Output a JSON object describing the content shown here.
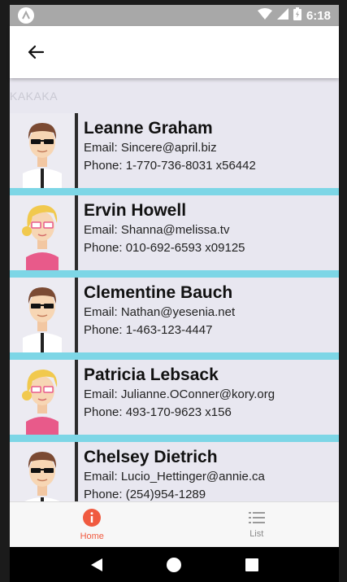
{
  "status_bar": {
    "time": "6:18",
    "accent": "#a8a8a8"
  },
  "app_bar": {
    "back_icon": "arrow-left-icon"
  },
  "section_label": "KAKAKA",
  "contacts": [
    {
      "name": "Leanne Graham",
      "email": "Email: Sincere@april.biz",
      "phone": "Phone: 1-770-736-8031 x56442",
      "avatar": "male-avatar"
    },
    {
      "name": "Ervin Howell",
      "email": "Email: Shanna@melissa.tv",
      "phone": "Phone: 010-692-6593 x09125",
      "avatar": "female-avatar"
    },
    {
      "name": "Clementine Bauch",
      "email": "Email: Nathan@yesenia.net",
      "phone": "Phone: 1-463-123-4447",
      "avatar": "male-avatar"
    },
    {
      "name": "Patricia Lebsack",
      "email": "Email: Julianne.OConner@kory.org",
      "phone": "Phone: 493-170-9623 x156",
      "avatar": "female-avatar"
    },
    {
      "name": "Chelsey Dietrich",
      "email": "Email: Lucio_Hettinger@annie.ca",
      "phone": "Phone: (254)954-1289",
      "avatar": "male-avatar"
    }
  ],
  "bottom_nav": {
    "home_label": "Home",
    "list_label": "List",
    "active_color": "#f05a40",
    "separator_color": "#7dd6e6"
  }
}
